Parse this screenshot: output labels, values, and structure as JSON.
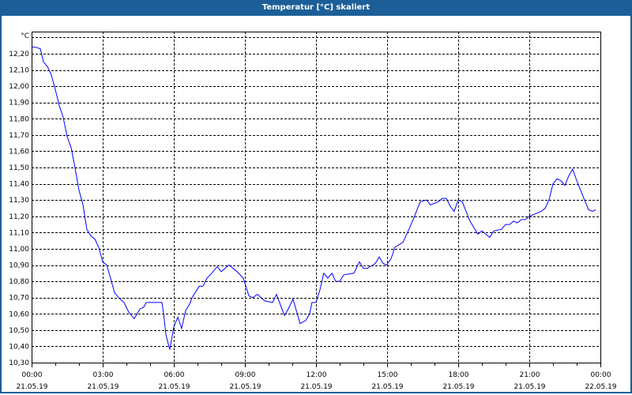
{
  "window": {
    "title": "Temperatur [°C] skaliert"
  },
  "colors": {
    "titlebar": "#1c5f98",
    "series": "#0000ff",
    "grid": "#000000"
  },
  "chart_data": {
    "type": "line",
    "title": "Temperatur [°C] skaliert",
    "ylabel": "°C",
    "xlabel": "",
    "ylim": [
      10.3,
      12.336
    ],
    "xlim_hours": [
      0,
      24
    ],
    "grid": true,
    "y_ticks": [
      "10,30",
      "10,40",
      "10,50",
      "10,60",
      "10,70",
      "10,80",
      "10,90",
      "11,00",
      "11,10",
      "11,20",
      "11,30",
      "11,40",
      "11,50",
      "11,60",
      "11,70",
      "11,80",
      "11,90",
      "12,00",
      "12,10",
      "12,20"
    ],
    "y_tick_values": [
      10.3,
      10.4,
      10.5,
      10.6,
      10.7,
      10.8,
      10.9,
      11.0,
      11.1,
      11.2,
      11.3,
      11.4,
      11.5,
      11.6,
      11.7,
      11.8,
      11.9,
      12.0,
      12.1,
      12.2
    ],
    "x_ticks": [
      {
        "hours": 0,
        "time": "00:00",
        "date": "21.05.19"
      },
      {
        "hours": 3,
        "time": "03:00",
        "date": "21.05.19"
      },
      {
        "hours": 6,
        "time": "06:00",
        "date": "21.05.19"
      },
      {
        "hours": 9,
        "time": "09:00",
        "date": "21.05.19"
      },
      {
        "hours": 12,
        "time": "12:00",
        "date": "21.05.19"
      },
      {
        "hours": 15,
        "time": "15:00",
        "date": "21.05.19"
      },
      {
        "hours": 18,
        "time": "18:00",
        "date": "21.05.19"
      },
      {
        "hours": 21,
        "time": "21:00",
        "date": "21.05.19"
      },
      {
        "hours": 24,
        "time": "00:00",
        "date": "22.05.19"
      }
    ],
    "series": [
      {
        "name": "Temperatur",
        "x_hours": [
          0,
          0.17,
          0.37,
          0.5,
          0.67,
          0.83,
          1,
          1.17,
          1.33,
          1.5,
          1.67,
          1.83,
          2,
          2.17,
          2.33,
          2.5,
          2.67,
          2.83,
          3,
          3.17,
          3.33,
          3.5,
          3.67,
          3.9,
          4.1,
          4.33,
          4.57,
          4.73,
          4.83,
          5.1,
          5.5,
          5.57,
          5.67,
          5.83,
          6,
          6.17,
          6.33,
          6.5,
          6.67,
          6.77,
          7.07,
          7.23,
          7.4,
          7.6,
          7.83,
          8,
          8.33,
          8.67,
          8.93,
          9.17,
          9.33,
          9.53,
          9.83,
          10.17,
          10.33,
          10.67,
          10.83,
          11.03,
          11.33,
          11.57,
          11.73,
          11.83,
          12,
          12.17,
          12.33,
          12.5,
          12.67,
          12.83,
          13,
          13.17,
          13.6,
          13.83,
          14,
          14.17,
          14.5,
          14.67,
          14.83,
          14.97,
          15.17,
          15.33,
          15.67,
          15.83,
          16.1,
          16.4,
          16.67,
          16.83,
          17.17,
          17.33,
          17.5,
          17.67,
          17.83,
          18,
          18.17,
          18.5,
          18.83,
          19,
          19.33,
          19.5,
          19.83,
          20,
          20.17,
          20.33,
          20.5,
          20.67,
          20.83,
          21,
          21.33,
          21.5,
          21.67,
          21.83,
          22,
          22.17,
          22.33,
          22.5,
          22.67,
          22.83,
          23,
          23.33,
          23.5,
          23.67,
          23.8
        ],
        "values": [
          12.24,
          12.24,
          12.23,
          12.15,
          12.12,
          12.07,
          11.98,
          11.88,
          11.81,
          11.69,
          11.62,
          11.5,
          11.36,
          11.27,
          11.12,
          11.08,
          11.06,
          11.01,
          10.92,
          10.9,
          10.82,
          10.73,
          10.7,
          10.67,
          10.61,
          10.57,
          10.63,
          10.64,
          10.67,
          10.67,
          10.67,
          10.6,
          10.47,
          10.38,
          10.52,
          10.58,
          10.51,
          10.62,
          10.66,
          10.7,
          10.77,
          10.77,
          10.82,
          10.85,
          10.89,
          10.86,
          10.9,
          10.86,
          10.82,
          10.71,
          10.7,
          10.72,
          10.68,
          10.67,
          10.72,
          10.59,
          10.63,
          10.69,
          10.54,
          10.56,
          10.6,
          10.67,
          10.67,
          10.75,
          10.85,
          10.82,
          10.85,
          10.8,
          10.8,
          10.84,
          10.85,
          10.92,
          10.88,
          10.88,
          10.91,
          10.95,
          10.91,
          10.9,
          10.94,
          11.01,
          11.04,
          11.09,
          11.18,
          11.29,
          11.3,
          11.27,
          11.29,
          11.31,
          11.31,
          11.26,
          11.23,
          11.3,
          11.29,
          11.17,
          11.09,
          11.11,
          11.07,
          11.11,
          11.12,
          11.15,
          11.15,
          11.17,
          11.16,
          11.18,
          11.18,
          11.2,
          11.22,
          11.23,
          11.25,
          11.3,
          11.4,
          11.43,
          11.42,
          11.39,
          11.45,
          11.49,
          11.42,
          11.3,
          11.24,
          11.23,
          11.24
        ]
      }
    ]
  }
}
